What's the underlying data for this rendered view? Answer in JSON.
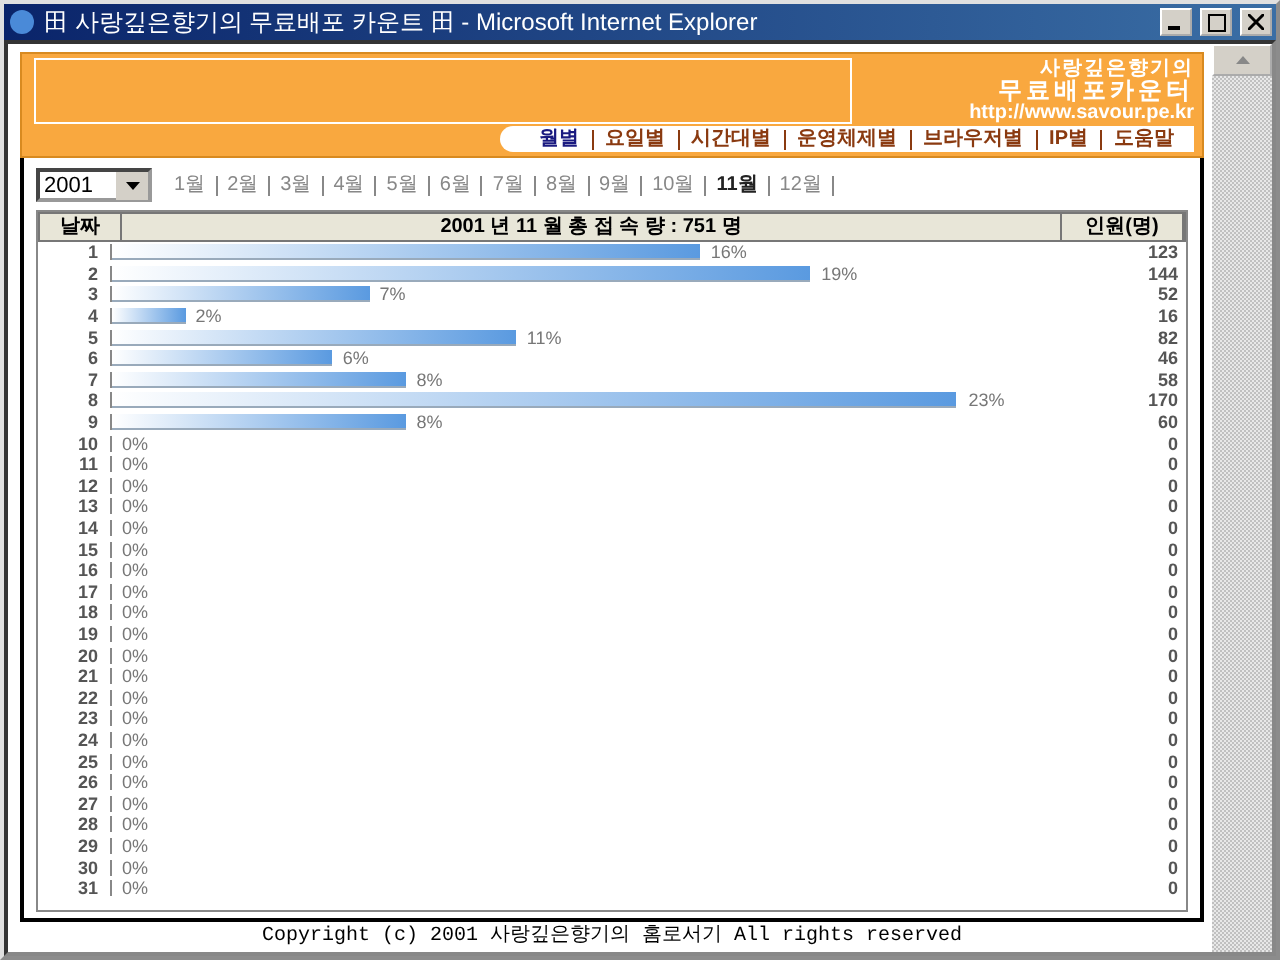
{
  "window": {
    "title": "田 사랑깊은향기의 무료배포 카운트 田 - Microsoft Internet Explorer"
  },
  "header": {
    "site_name": "사랑깊은향기의",
    "product": "무료배포카운터",
    "url": "http://www.savour.pe.kr"
  },
  "nav": [
    {
      "label": "월별",
      "selected": true
    },
    {
      "label": "요일별",
      "selected": false
    },
    {
      "label": "시간대별",
      "selected": false
    },
    {
      "label": "운영체제별",
      "selected": false
    },
    {
      "label": "브라우저별",
      "selected": false
    },
    {
      "label": "IP별",
      "selected": false
    },
    {
      "label": "도움말",
      "selected": false
    }
  ],
  "year_select": {
    "value": "2001"
  },
  "months": [
    {
      "label": "1월",
      "selected": false
    },
    {
      "label": "2월",
      "selected": false
    },
    {
      "label": "3월",
      "selected": false
    },
    {
      "label": "4월",
      "selected": false
    },
    {
      "label": "5월",
      "selected": false
    },
    {
      "label": "6월",
      "selected": false
    },
    {
      "label": "7월",
      "selected": false
    },
    {
      "label": "8월",
      "selected": false
    },
    {
      "label": "9월",
      "selected": false
    },
    {
      "label": "10월",
      "selected": false
    },
    {
      "label": "11월",
      "selected": true
    },
    {
      "label": "12월",
      "selected": false
    }
  ],
  "table": {
    "columns": [
      "날짜",
      "2001 년 11 월 총 접 속 량 : 751 명",
      "인원(명)"
    ],
    "rows": [
      {
        "day": "1",
        "level": 0.64,
        "percent": "16%",
        "count": "123"
      },
      {
        "day": "2",
        "level": 0.76,
        "percent": "19%",
        "count": "144"
      },
      {
        "day": "3",
        "level": 0.28,
        "percent": "7%",
        "count": "52"
      },
      {
        "day": "4",
        "level": 0.08,
        "percent": "2%",
        "count": "16"
      },
      {
        "day": "5",
        "level": 0.44,
        "percent": "11%",
        "count": "82"
      },
      {
        "day": "6",
        "level": 0.24,
        "percent": "6%",
        "count": "46"
      },
      {
        "day": "7",
        "level": 0.32,
        "percent": "8%",
        "count": "58"
      },
      {
        "day": "8",
        "level": 0.92,
        "percent": "23%",
        "count": "170"
      },
      {
        "day": "9",
        "level": 0.32,
        "percent": "8%",
        "count": "60"
      },
      {
        "day": "10",
        "level": 0,
        "percent": "0%",
        "count": "0"
      },
      {
        "day": "11",
        "level": 0,
        "percent": "0%",
        "count": "0"
      },
      {
        "day": "12",
        "level": 0,
        "percent": "0%",
        "count": "0"
      },
      {
        "day": "13",
        "level": 0,
        "percent": "0%",
        "count": "0"
      },
      {
        "day": "14",
        "level": 0,
        "percent": "0%",
        "count": "0"
      },
      {
        "day": "15",
        "level": 0,
        "percent": "0%",
        "count": "0"
      },
      {
        "day": "16",
        "level": 0,
        "percent": "0%",
        "count": "0"
      },
      {
        "day": "17",
        "level": 0,
        "percent": "0%",
        "count": "0"
      },
      {
        "day": "18",
        "level": 0,
        "percent": "0%",
        "count": "0"
      },
      {
        "day": "19",
        "level": 0,
        "percent": "0%",
        "count": "0"
      },
      {
        "day": "20",
        "level": 0,
        "percent": "0%",
        "count": "0"
      },
      {
        "day": "21",
        "level": 0,
        "percent": "0%",
        "count": "0"
      },
      {
        "day": "22",
        "level": 0,
        "percent": "0%",
        "count": "0"
      },
      {
        "day": "23",
        "level": 0,
        "percent": "0%",
        "count": "0"
      },
      {
        "day": "24",
        "level": 0,
        "percent": "0%",
        "count": "0"
      },
      {
        "day": "25",
        "level": 0,
        "percent": "0%",
        "count": "0"
      },
      {
        "day": "26",
        "level": 0,
        "percent": "0%",
        "count": "0"
      },
      {
        "day": "27",
        "level": 0,
        "percent": "0%",
        "count": "0"
      },
      {
        "day": "28",
        "level": 0,
        "percent": "0%",
        "count": "0"
      },
      {
        "day": "29",
        "level": 0,
        "percent": "0%",
        "count": "0"
      },
      {
        "day": "30",
        "level": 0,
        "percent": "0%",
        "count": "0"
      },
      {
        "day": "31",
        "level": 0,
        "percent": "0%",
        "count": "0"
      }
    ]
  },
  "footer": "Copyright (c) 2001 사랑깊은향기의 홈로서기 All rights reserved"
}
